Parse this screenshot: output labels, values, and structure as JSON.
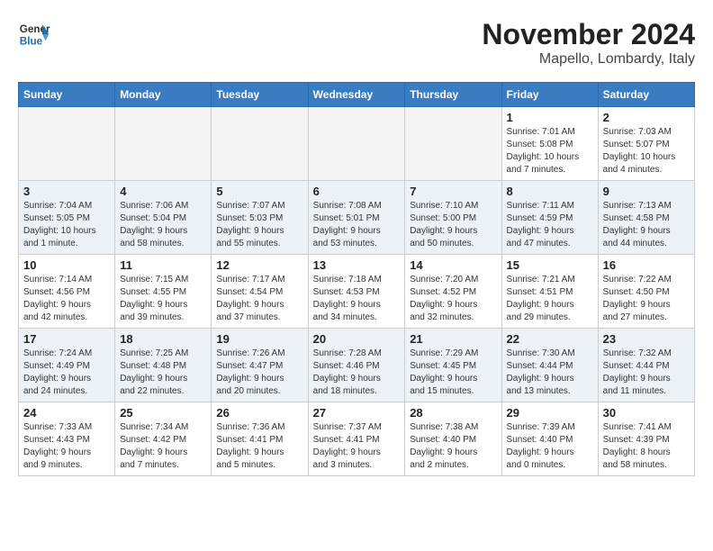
{
  "logo": {
    "line1": "General",
    "line2": "Blue"
  },
  "title": "November 2024",
  "location": "Mapello, Lombardy, Italy",
  "days_of_week": [
    "Sunday",
    "Monday",
    "Tuesday",
    "Wednesday",
    "Thursday",
    "Friday",
    "Saturday"
  ],
  "weeks": [
    {
      "alt": false,
      "days": [
        {
          "num": "",
          "info": "",
          "empty": true
        },
        {
          "num": "",
          "info": "",
          "empty": true
        },
        {
          "num": "",
          "info": "",
          "empty": true
        },
        {
          "num": "",
          "info": "",
          "empty": true
        },
        {
          "num": "",
          "info": "",
          "empty": true
        },
        {
          "num": "1",
          "info": "Sunrise: 7:01 AM\nSunset: 5:08 PM\nDaylight: 10 hours\nand 7 minutes.",
          "empty": false
        },
        {
          "num": "2",
          "info": "Sunrise: 7:03 AM\nSunset: 5:07 PM\nDaylight: 10 hours\nand 4 minutes.",
          "empty": false
        }
      ]
    },
    {
      "alt": true,
      "days": [
        {
          "num": "3",
          "info": "Sunrise: 7:04 AM\nSunset: 5:05 PM\nDaylight: 10 hours\nand 1 minute.",
          "empty": false
        },
        {
          "num": "4",
          "info": "Sunrise: 7:06 AM\nSunset: 5:04 PM\nDaylight: 9 hours\nand 58 minutes.",
          "empty": false
        },
        {
          "num": "5",
          "info": "Sunrise: 7:07 AM\nSunset: 5:03 PM\nDaylight: 9 hours\nand 55 minutes.",
          "empty": false
        },
        {
          "num": "6",
          "info": "Sunrise: 7:08 AM\nSunset: 5:01 PM\nDaylight: 9 hours\nand 53 minutes.",
          "empty": false
        },
        {
          "num": "7",
          "info": "Sunrise: 7:10 AM\nSunset: 5:00 PM\nDaylight: 9 hours\nand 50 minutes.",
          "empty": false
        },
        {
          "num": "8",
          "info": "Sunrise: 7:11 AM\nSunset: 4:59 PM\nDaylight: 9 hours\nand 47 minutes.",
          "empty": false
        },
        {
          "num": "9",
          "info": "Sunrise: 7:13 AM\nSunset: 4:58 PM\nDaylight: 9 hours\nand 44 minutes.",
          "empty": false
        }
      ]
    },
    {
      "alt": false,
      "days": [
        {
          "num": "10",
          "info": "Sunrise: 7:14 AM\nSunset: 4:56 PM\nDaylight: 9 hours\nand 42 minutes.",
          "empty": false
        },
        {
          "num": "11",
          "info": "Sunrise: 7:15 AM\nSunset: 4:55 PM\nDaylight: 9 hours\nand 39 minutes.",
          "empty": false
        },
        {
          "num": "12",
          "info": "Sunrise: 7:17 AM\nSunset: 4:54 PM\nDaylight: 9 hours\nand 37 minutes.",
          "empty": false
        },
        {
          "num": "13",
          "info": "Sunrise: 7:18 AM\nSunset: 4:53 PM\nDaylight: 9 hours\nand 34 minutes.",
          "empty": false
        },
        {
          "num": "14",
          "info": "Sunrise: 7:20 AM\nSunset: 4:52 PM\nDaylight: 9 hours\nand 32 minutes.",
          "empty": false
        },
        {
          "num": "15",
          "info": "Sunrise: 7:21 AM\nSunset: 4:51 PM\nDaylight: 9 hours\nand 29 minutes.",
          "empty": false
        },
        {
          "num": "16",
          "info": "Sunrise: 7:22 AM\nSunset: 4:50 PM\nDaylight: 9 hours\nand 27 minutes.",
          "empty": false
        }
      ]
    },
    {
      "alt": true,
      "days": [
        {
          "num": "17",
          "info": "Sunrise: 7:24 AM\nSunset: 4:49 PM\nDaylight: 9 hours\nand 24 minutes.",
          "empty": false
        },
        {
          "num": "18",
          "info": "Sunrise: 7:25 AM\nSunset: 4:48 PM\nDaylight: 9 hours\nand 22 minutes.",
          "empty": false
        },
        {
          "num": "19",
          "info": "Sunrise: 7:26 AM\nSunset: 4:47 PM\nDaylight: 9 hours\nand 20 minutes.",
          "empty": false
        },
        {
          "num": "20",
          "info": "Sunrise: 7:28 AM\nSunset: 4:46 PM\nDaylight: 9 hours\nand 18 minutes.",
          "empty": false
        },
        {
          "num": "21",
          "info": "Sunrise: 7:29 AM\nSunset: 4:45 PM\nDaylight: 9 hours\nand 15 minutes.",
          "empty": false
        },
        {
          "num": "22",
          "info": "Sunrise: 7:30 AM\nSunset: 4:44 PM\nDaylight: 9 hours\nand 13 minutes.",
          "empty": false
        },
        {
          "num": "23",
          "info": "Sunrise: 7:32 AM\nSunset: 4:44 PM\nDaylight: 9 hours\nand 11 minutes.",
          "empty": false
        }
      ]
    },
    {
      "alt": false,
      "days": [
        {
          "num": "24",
          "info": "Sunrise: 7:33 AM\nSunset: 4:43 PM\nDaylight: 9 hours\nand 9 minutes.",
          "empty": false
        },
        {
          "num": "25",
          "info": "Sunrise: 7:34 AM\nSunset: 4:42 PM\nDaylight: 9 hours\nand 7 minutes.",
          "empty": false
        },
        {
          "num": "26",
          "info": "Sunrise: 7:36 AM\nSunset: 4:41 PM\nDaylight: 9 hours\nand 5 minutes.",
          "empty": false
        },
        {
          "num": "27",
          "info": "Sunrise: 7:37 AM\nSunset: 4:41 PM\nDaylight: 9 hours\nand 3 minutes.",
          "empty": false
        },
        {
          "num": "28",
          "info": "Sunrise: 7:38 AM\nSunset: 4:40 PM\nDaylight: 9 hours\nand 2 minutes.",
          "empty": false
        },
        {
          "num": "29",
          "info": "Sunrise: 7:39 AM\nSunset: 4:40 PM\nDaylight: 9 hours\nand 0 minutes.",
          "empty": false
        },
        {
          "num": "30",
          "info": "Sunrise: 7:41 AM\nSunset: 4:39 PM\nDaylight: 8 hours\nand 58 minutes.",
          "empty": false
        }
      ]
    }
  ]
}
